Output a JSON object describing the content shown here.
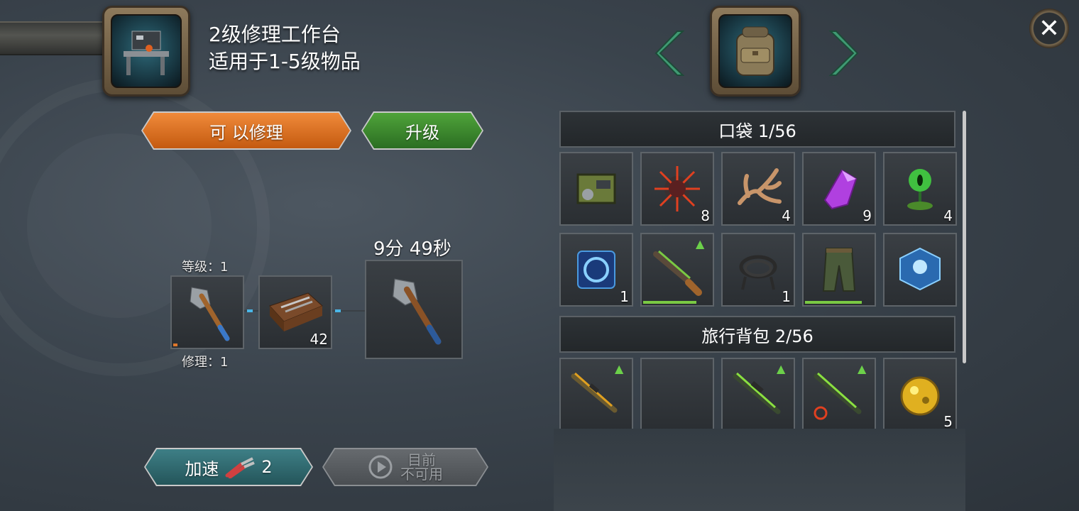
{
  "workbench": {
    "title_line1": "2级修理工作台",
    "title_line2": "适用于1-5级物品",
    "icon": "workbench-icon"
  },
  "actions": {
    "repair_label": "可 以修理",
    "upgrade_label": "升级"
  },
  "repair_chain": {
    "level_label": "等级：1",
    "repair_label": "修理：1",
    "input_item_icon": "axe-icon",
    "kit_icon": "toolbox-icon",
    "kit_count": "42",
    "output_item_icon": "axe-icon",
    "timer": "9分 49秒"
  },
  "bottom": {
    "speed_label": "加速",
    "speed_icon": "pliers-icon",
    "speed_count": "2",
    "disabled_line1": "目前",
    "disabled_line2": "不可用",
    "disabled_icon": "play-icon"
  },
  "inventory": {
    "bag_icon": "backpack-icon",
    "pocket_header": "口袋 1/56",
    "travel_header": "旅行背包 2/56",
    "pocket_items": [
      {
        "icon": "generator-icon",
        "count": "",
        "upgrade": false,
        "durability": null
      },
      {
        "icon": "spiky-mine-icon",
        "count": "8",
        "upgrade": false,
        "durability": null
      },
      {
        "icon": "antler-icon",
        "count": "4",
        "upgrade": false,
        "durability": null
      },
      {
        "icon": "purple-crystal-icon",
        "count": "9",
        "upgrade": false,
        "durability": null
      },
      {
        "icon": "green-eye-orb-icon",
        "count": "4",
        "upgrade": false,
        "durability": null
      },
      {
        "icon": "blue-disk-icon",
        "count": "1",
        "upgrade": false,
        "durability": null
      },
      {
        "icon": "shotgun-icon",
        "count": "",
        "upgrade": true,
        "durability": 0.75
      },
      {
        "icon": "cable-icon",
        "count": "1",
        "upgrade": false,
        "durability": null
      },
      {
        "icon": "camo-pants-icon",
        "count": "",
        "upgrade": false,
        "durability": 0.8
      },
      {
        "icon": "blue-box-icon",
        "count": "",
        "upgrade": false,
        "durability": null
      }
    ],
    "travel_items": [
      {
        "icon": "gold-rifle-icon",
        "count": "",
        "upgrade": true
      },
      {
        "icon": "empty-slot",
        "count": "",
        "upgrade": false
      },
      {
        "icon": "green-sniper-icon",
        "count": "",
        "upgrade": true
      },
      {
        "icon": "biohazard-rifle-icon",
        "count": "",
        "upgrade": true
      },
      {
        "icon": "gold-ore-icon",
        "count": "5",
        "upgrade": false
      }
    ]
  },
  "colors": {
    "repair_orange": "#e0772a",
    "upgrade_green": "#3c8a2e",
    "speed_teal": "#2f6b70",
    "nav_arrow": "#3f9a73"
  }
}
